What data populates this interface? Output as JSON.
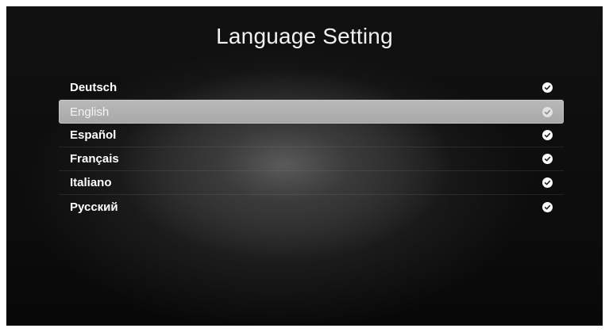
{
  "header": {
    "title": "Language Setting"
  },
  "languages": [
    {
      "label": "Deutsch",
      "selected": false
    },
    {
      "label": "English",
      "selected": true
    },
    {
      "label": "Español",
      "selected": false
    },
    {
      "label": "Français",
      "selected": false
    },
    {
      "label": "Italiano",
      "selected": false
    },
    {
      "label": "Русский",
      "selected": false
    }
  ],
  "icons": {
    "row_indicator": "check-circle-icon"
  },
  "colors": {
    "background": "#0c0c0c",
    "selected_row": "#b0b0b0",
    "text": "#ffffff"
  }
}
